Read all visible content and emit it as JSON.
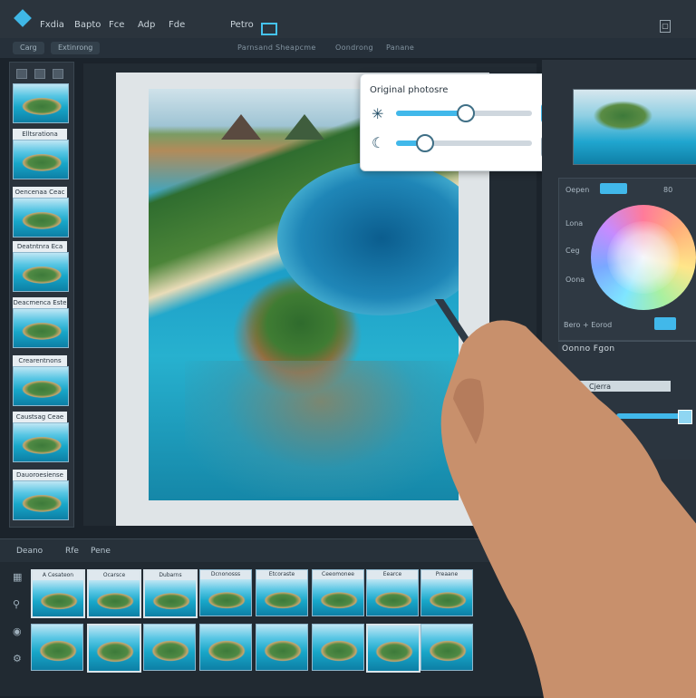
{
  "menubar": {
    "items": [
      "Fxdia",
      "Bapto",
      "Fce",
      "Adp",
      "Fde",
      "Petro"
    ]
  },
  "toolbar": {
    "left_buttons": [
      "Carg",
      "Extinrong"
    ],
    "labels": [
      "Parnsand Sheapcme",
      "Oondrong",
      "Panane"
    ]
  },
  "left_panel": {
    "thumb_captions": [
      "",
      "Elltsrationa",
      "Oencenaa Ceac",
      "Deatntnra Eca",
      "Deacmenca Este",
      "Crearentnons",
      "Caustsag Ceae",
      "Dauoroesiense"
    ]
  },
  "popup": {
    "title": "Original photosre",
    "slider1_value": 0.5,
    "slider2_value": 0.2
  },
  "color_panel": {
    "header_chip_label": "Oepen",
    "header_value": "80",
    "labels": [
      "Lona",
      "Ceg",
      "Oona"
    ],
    "bottom_label": "Bero + Eorod"
  },
  "properties": {
    "header": "Oonno  Fgon",
    "field_label": "Cjerra"
  },
  "filmstrip": {
    "labels": [
      "Deano",
      "Rfe",
      "Pene"
    ],
    "row1_captions": [
      "A Cesateon",
      "Ocarsce",
      "Dubarns",
      "Dcnonosss",
      "Etcoraste",
      "Ceeomonee",
      "Eearce",
      "Preaane"
    ],
    "row2_captions": [
      "",
      "",
      "",
      "",
      "",
      "",
      "",
      ""
    ]
  },
  "colors": {
    "accent": "#41b8ea",
    "panel": "#2a333c",
    "background": "#1b232b"
  }
}
